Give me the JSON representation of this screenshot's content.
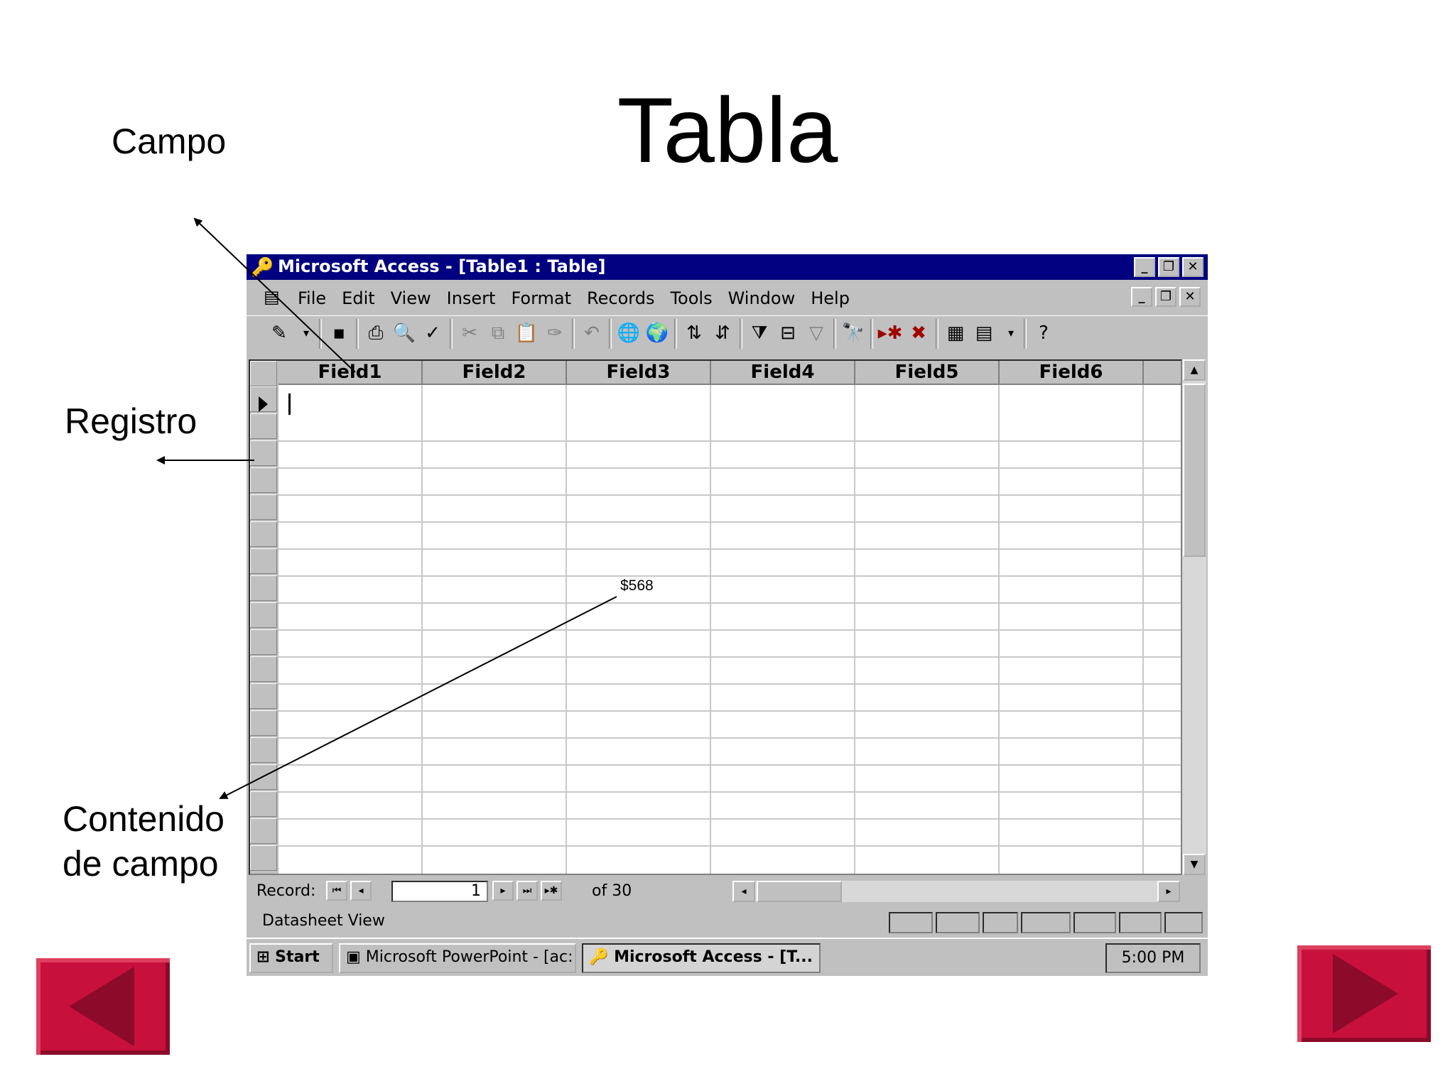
{
  "slide": {
    "title": "Tabla",
    "label_campo": "Campo",
    "label_registro": "Registro",
    "label_contenido_1": "Contenido",
    "label_contenido_2": "de campo"
  },
  "window": {
    "title": "Microsoft Access - [Table1 : Table]",
    "menu": [
      "File",
      "Edit",
      "View",
      "Insert",
      "Format",
      "Records",
      "Tools",
      "Window",
      "Help"
    ],
    "columns": [
      "Field1",
      "Field2",
      "Field3",
      "Field4",
      "Field5",
      "Field6"
    ],
    "cell_value": "$568",
    "record_label": "Record:",
    "record_number": "1",
    "record_of": "of  30",
    "status_text": "Datasheet View"
  },
  "taskbar": {
    "start": "Start",
    "task1": "Microsoft PowerPoint - [ac:",
    "task2": "Microsoft Access - [T...",
    "clock": "5:00 PM"
  },
  "icons": {
    "nav_prev": "left-triangle-icon",
    "nav_next": "right-triangle-icon"
  },
  "colors": {
    "nav_button": "#c8103c",
    "title_bar": "#000080"
  }
}
